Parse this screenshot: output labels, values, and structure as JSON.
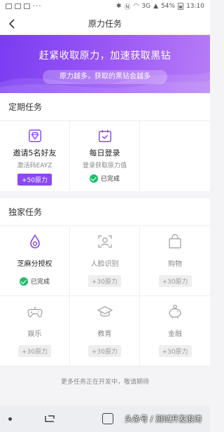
{
  "status_bar": {
    "signal": "3G",
    "battery": "54%",
    "time": "13:10"
  },
  "header": {
    "title": "原力任务"
  },
  "banner": {
    "title": "赶紧收取原力，加速获取黑钻",
    "subtitle": "原力越多，获取的黑钻会越多",
    "colors": {
      "start": "#7a3cf2",
      "end": "#b77df6"
    }
  },
  "periodic": {
    "heading": "定期任务",
    "tasks": [
      {
        "title": "邀请5名好友",
        "desc": "激活码EAYZ",
        "reward": "+50原力",
        "icon": "diamond-icon"
      },
      {
        "title": "每日登录",
        "desc": "登录获取原力值",
        "status": "已完成",
        "icon": "calendar-check-icon"
      }
    ]
  },
  "exclusive": {
    "heading": "独家任务",
    "tasks": [
      {
        "label": "芝麻分授权",
        "status": "已完成",
        "icon": "sesame-drop-icon"
      },
      {
        "label": "人脸识别",
        "reward": "+30原力",
        "icon": "face-scan-icon"
      },
      {
        "label": "购物",
        "reward": "+30原力",
        "icon": "shopping-bag-icon"
      },
      {
        "label": "娱乐",
        "reward": "+30原力",
        "icon": "gamepad-icon"
      },
      {
        "label": "教育",
        "reward": "+30原力",
        "icon": "graduation-cap-icon"
      },
      {
        "label": "金融",
        "reward": "+30原力",
        "icon": "piggy-bank-icon"
      }
    ]
  },
  "footer": {
    "note": "更多任务正在开发中，敬请期待"
  },
  "watermark": "头条号 / 测试开发浪涛",
  "accent": "#8a48f3",
  "success": "#1fbf6b"
}
